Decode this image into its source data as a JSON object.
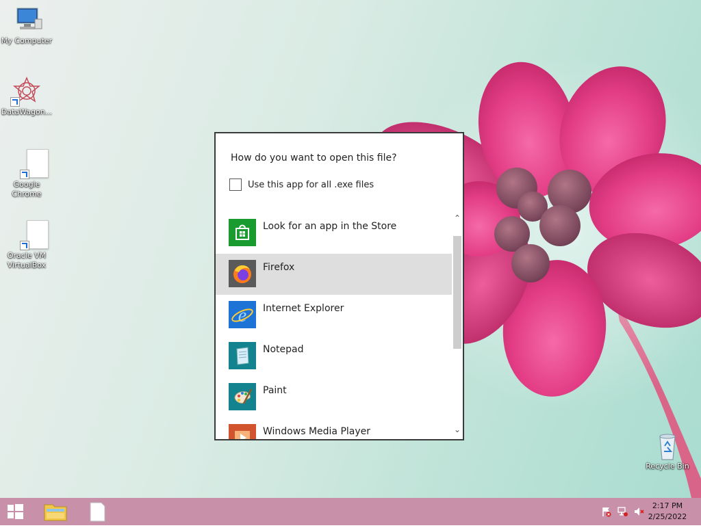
{
  "desktop": {
    "icons": [
      {
        "label": "My Computer"
      },
      {
        "label": "DataWagon..."
      },
      {
        "label": "Google Chrome"
      },
      {
        "label": "Oracle VM VirtualBox"
      },
      {
        "label": "Recycle Bin"
      }
    ]
  },
  "dialog": {
    "question": "How do you want to open this file?",
    "remember_label": "Use this app for all .exe files",
    "remember_checked": false,
    "apps": [
      {
        "label": "Look for an app in the Store",
        "icon": "store-icon",
        "color": "#1a9b2f"
      },
      {
        "label": "Firefox",
        "icon": "firefox-icon",
        "color": "#5a5a5a",
        "selected": true
      },
      {
        "label": "Internet Explorer",
        "icon": "internet-explorer-icon",
        "color": "#1e73d6"
      },
      {
        "label": "Notepad",
        "icon": "notepad-icon",
        "color": "#13838f"
      },
      {
        "label": "Paint",
        "icon": "paint-icon",
        "color": "#13838f"
      },
      {
        "label": "Windows Media Player",
        "icon": "media-player-icon",
        "color": "#d2542e"
      }
    ],
    "scroll_up": "⌃",
    "scroll_down": "⌄"
  },
  "taskbar": {
    "clock_time": "2:17 PM",
    "clock_date": "2/25/2022",
    "color": "#c891a9"
  }
}
